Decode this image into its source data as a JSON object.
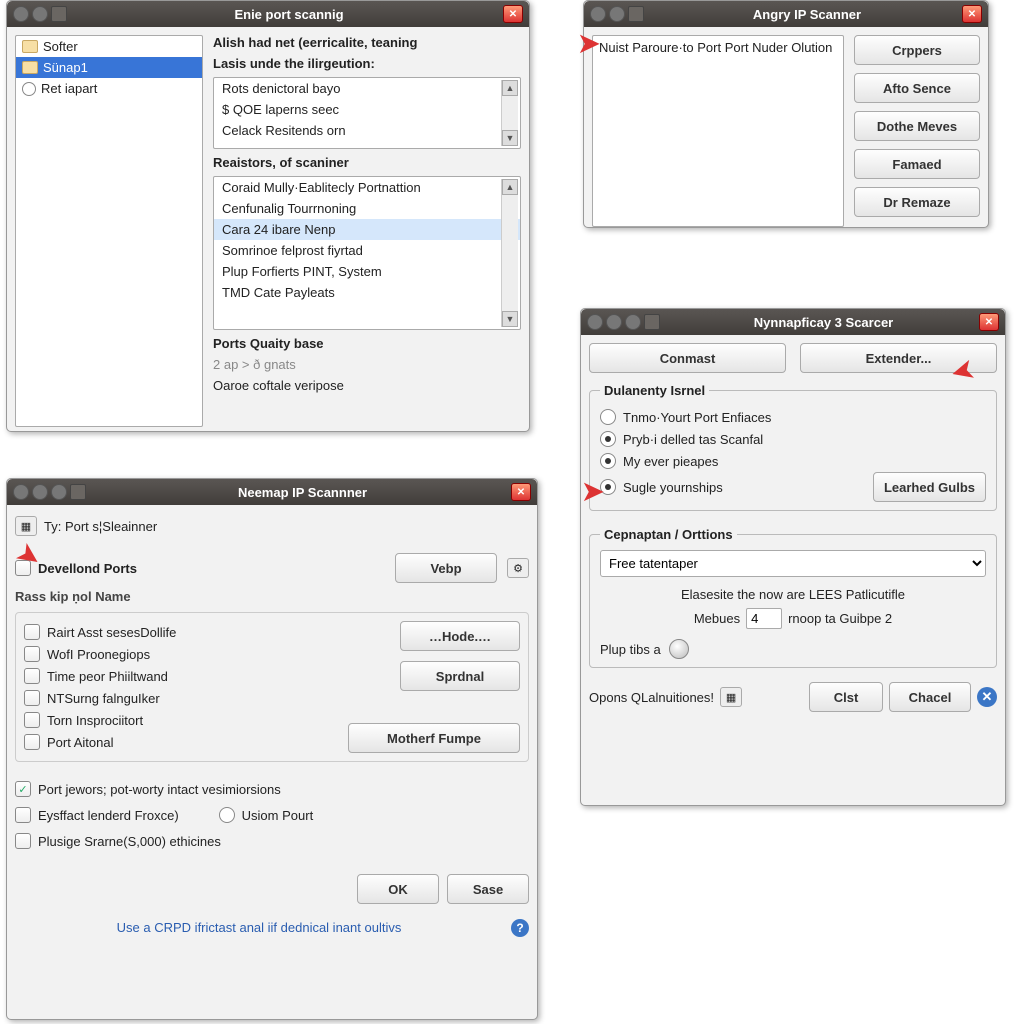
{
  "win1": {
    "title": "Enie port scannig",
    "tree": [
      "Softer",
      "Sünap1",
      "Ret iapart"
    ],
    "heading1": "Alish had net (eerricalite, teaning",
    "heading2": "Lasis unde the ilirgeution:",
    "list1": [
      "Rots denictoral bayo",
      "$ QOE laperns seec",
      "Celack Resitends orn"
    ],
    "heading3": "Reaistors, of scaniner",
    "list2": [
      "Coraid Mully·Eablitecly Portnattion",
      "Cenfunalig Tourrnoning",
      "Cara 24 ibare Nenp",
      "Somrinoe felprost fiyrtad",
      "Plup Forfierts PINT, System",
      "TMD Cate Payleats"
    ],
    "label_ports": "Ports Quaity base",
    "label_ports_sub": "2 ap > ð gnats",
    "label_oaroe": "Oaroe coftale veripose"
  },
  "win2": {
    "title": "Angry IP Scanner",
    "textarea": "Nuist Paroure·to Port Port Nuder Olution",
    "buttons": [
      "Crppers",
      "Afto Sence",
      "Dothe Meves",
      "Famaed",
      "Dr Remaze"
    ]
  },
  "win3": {
    "title": "Neemap IP Scannner",
    "ty_label": "Ty: Port s¦Sleainner",
    "dev_label": "Devellond Ports",
    "rass_label": "Rass kip ṇol Name",
    "btn_vebp": "Vebp",
    "btn_hode": "…Hode.…",
    "btn_sprdnal": "Sprdnal",
    "btn_mother": "Motherf Fumpe",
    "checks": [
      "Rairt Asst sesesDollife",
      "WofI Proonegiops",
      "Time peor Phiiltwand",
      "NTSurng falnguIker",
      "Torn Insprociitort",
      "Port Aitonal"
    ],
    "chk_port_jewors": "Port jewors; pot-worty intact vesimiorsions",
    "chk_eysffact": "Eysffact lenderd Froxce)",
    "chk_plusige": "Plusige Srarne(S,000) ethicines",
    "rad_usiom": "Usiom Pourt",
    "btn_ok": "OK",
    "btn_sase": "Sase",
    "link": "Use a CRPD ifrictast anal iif dednical inant oultivs"
  },
  "win4": {
    "title": "Nynnapficay 3 Scarcer",
    "btn_conmast": "Conmast",
    "btn_extender": "Extender...",
    "group1_title": "Dulanenty Isrnel",
    "radios": [
      "Tnmo·Yourt Port Enfiaces",
      "Pryb·i delled tas Scanfal",
      "My ever pieapes",
      "Sugle yournships"
    ],
    "btn_learhed": "Learhed Gulbs",
    "group2_title": "Cepnaptan / Orttions",
    "select_val": "Free tatentaper",
    "desc": "Elasesite the now are LEES Patlicutifle",
    "mebues": "Mebues",
    "mebues_val": "4",
    "mebues_suffix": "rnoop ta Guibpe 2",
    "plup": "Plup tibs a",
    "footer": "Opons QLalnuitiones!",
    "btn_clst": "Clst",
    "btn_chacel": "Chacel"
  }
}
